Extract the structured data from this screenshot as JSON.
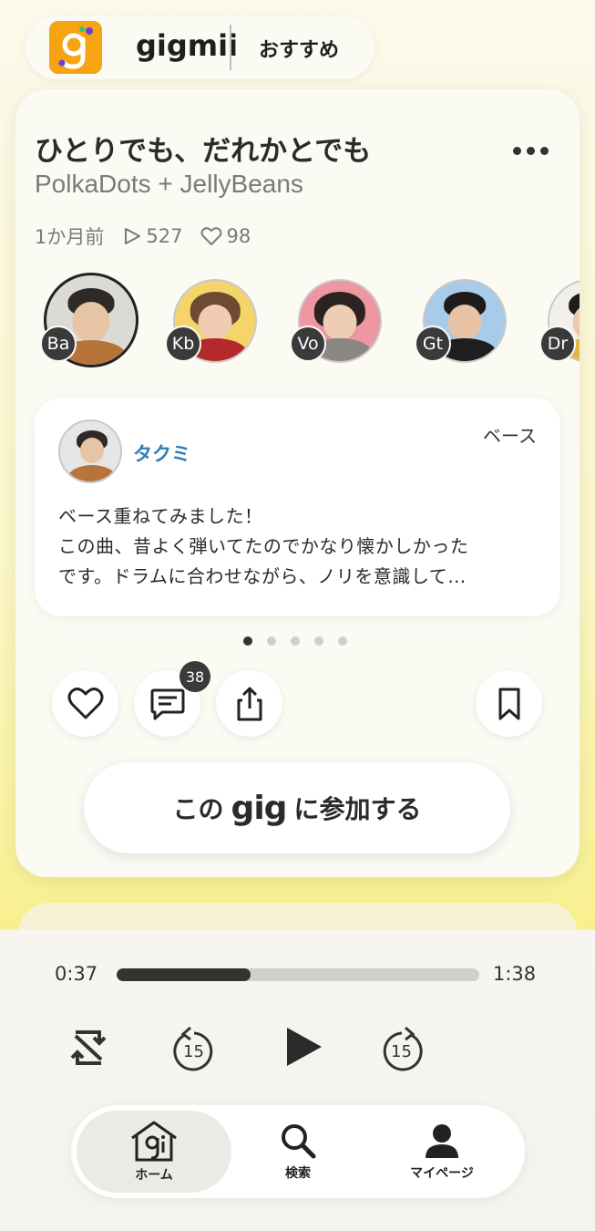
{
  "header": {
    "logo_text": "gigmii",
    "tab_label": "おすすめ"
  },
  "post": {
    "title": "ひとりでも、だれかとでも",
    "artist": "PolkaDots + JellyBeans",
    "posted": "1か月前",
    "plays": "527",
    "likes": "98",
    "members": [
      {
        "part": "Ba",
        "name": "タクミ"
      },
      {
        "part": "Kb"
      },
      {
        "part": "Vo"
      },
      {
        "part": "Gt"
      },
      {
        "part": "Dr"
      }
    ],
    "comment": {
      "user": "タクミ",
      "part": "ベース",
      "lines": [
        "ベース重ねてみました！",
        "この曲、昔よく弾いてたのでかなり懐かしかった",
        "です。ドラムに合わせながら、ノリを意識して…"
      ]
    },
    "comment_count": "38",
    "join": {
      "prefix": "この",
      "gig": "gig",
      "suffix": "に参加する"
    }
  },
  "player": {
    "current_time": "0:37",
    "total_time": "1:38",
    "progress": 0.37,
    "skip_back": "15",
    "skip_forward": "15"
  },
  "nav": {
    "home": "ホーム",
    "search": "検索",
    "mypage": "マイページ"
  },
  "colors": {
    "accent_orange": "#f7a413",
    "username_blue": "#2f7fb3",
    "background_yellow": "#f7ef86"
  }
}
